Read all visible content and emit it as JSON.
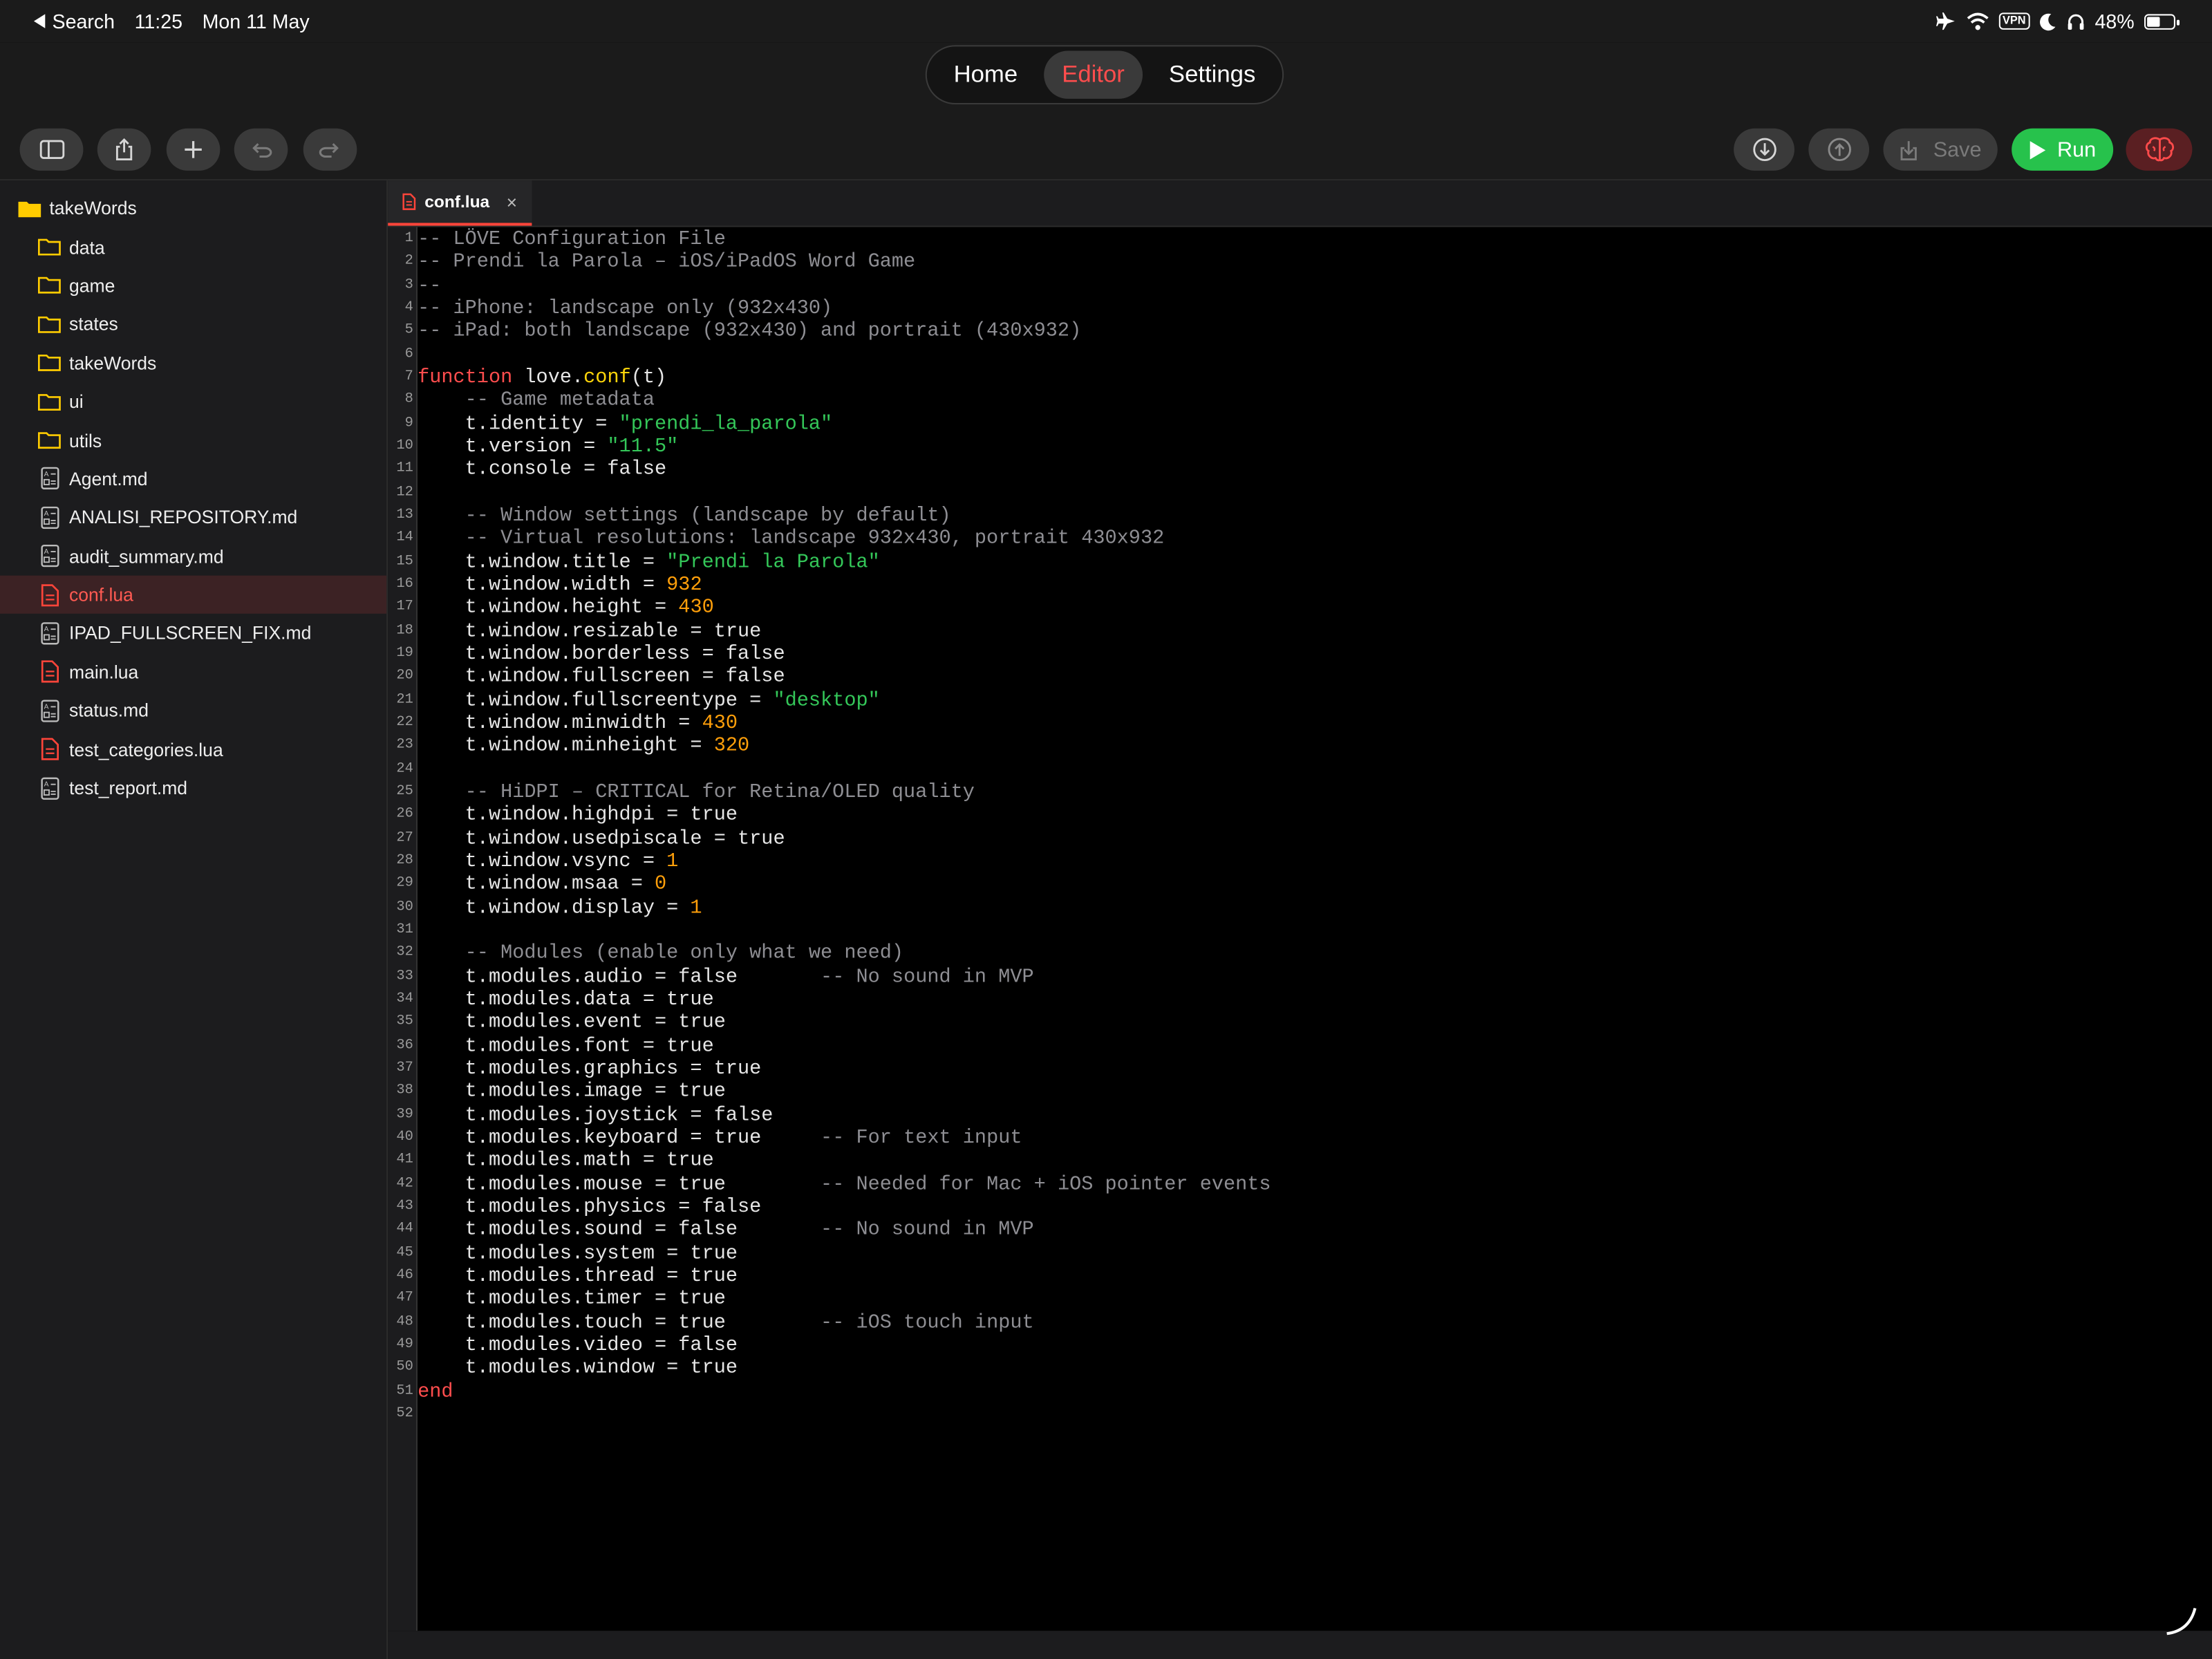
{
  "status_bar": {
    "back_label": "Search",
    "time": "11:25",
    "date": "Mon 11 May",
    "vpn_label": "VPN",
    "battery_percent": "48%",
    "battery_level": 0.48,
    "icons": [
      "airplane-icon",
      "wifi-icon",
      "vpn-badge",
      "moon-icon",
      "headphones-icon",
      "battery-icon"
    ]
  },
  "nav": {
    "tabs": [
      {
        "label": "Home",
        "active": false
      },
      {
        "label": "Editor",
        "active": true
      },
      {
        "label": "Settings",
        "active": false
      }
    ]
  },
  "toolbar": {
    "left_icons": [
      "sidebar-toggle-icon",
      "share-icon",
      "plus-icon",
      "undo-icon",
      "redo-icon"
    ],
    "download_icon": "download-icon",
    "upload_icon": "upload-icon",
    "save_label": "Save",
    "run_label": "Run",
    "ai_icon": "brain-icon"
  },
  "sidebar": {
    "root": "takeWords",
    "items": [
      {
        "label": "data",
        "type": "folder"
      },
      {
        "label": "game",
        "type": "folder"
      },
      {
        "label": "states",
        "type": "folder"
      },
      {
        "label": "takeWords",
        "type": "folder"
      },
      {
        "label": "ui",
        "type": "folder"
      },
      {
        "label": "utils",
        "type": "folder"
      },
      {
        "label": "Agent.md",
        "type": "md"
      },
      {
        "label": "ANALISI_REPOSITORY.md",
        "type": "md"
      },
      {
        "label": "audit_summary.md",
        "type": "md"
      },
      {
        "label": "conf.lua",
        "type": "lua",
        "selected": true
      },
      {
        "label": "IPAD_FULLSCREEN_FIX.md",
        "type": "md"
      },
      {
        "label": "main.lua",
        "type": "lua"
      },
      {
        "label": "status.md",
        "type": "md"
      },
      {
        "label": "test_categories.lua",
        "type": "lua"
      },
      {
        "label": "test_report.md",
        "type": "md"
      }
    ]
  },
  "editor": {
    "tab_label": "conf.lua",
    "close_glyph": "×",
    "lines": [
      [
        {
          "t": "-- LÖVE Configuration File",
          "k": "comment"
        }
      ],
      [
        {
          "t": "-- Prendi la Parola – iOS/iPadOS Word Game",
          "k": "comment"
        }
      ],
      [
        {
          "t": "--",
          "k": "comment"
        }
      ],
      [
        {
          "t": "-- iPhone: landscape only (932x430)",
          "k": "comment"
        }
      ],
      [
        {
          "t": "-- iPad: both landscape (932x430) and portrait (430x932)",
          "k": "comment"
        }
      ],
      [],
      [
        {
          "t": "function",
          "k": "keyword"
        },
        {
          "t": " love.",
          "k": "plain"
        },
        {
          "t": "conf",
          "k": "func"
        },
        {
          "t": "(t)",
          "k": "plain"
        }
      ],
      [
        {
          "t": "    -- Game metadata",
          "k": "comment"
        }
      ],
      [
        {
          "t": "    t.identity = ",
          "k": "plain"
        },
        {
          "t": "\"prendi_la_parola\"",
          "k": "string"
        }
      ],
      [
        {
          "t": "    t.version = ",
          "k": "plain"
        },
        {
          "t": "\"11.5\"",
          "k": "string"
        }
      ],
      [
        {
          "t": "    t.console = false",
          "k": "plain"
        }
      ],
      [],
      [
        {
          "t": "    -- Window settings (landscape by default)",
          "k": "comment"
        }
      ],
      [
        {
          "t": "    -- Virtual resolutions: landscape 932x430, portrait 430x932",
          "k": "comment"
        }
      ],
      [
        {
          "t": "    t.window.title = ",
          "k": "plain"
        },
        {
          "t": "\"Prendi la Parola\"",
          "k": "string"
        }
      ],
      [
        {
          "t": "    t.window.width = ",
          "k": "plain"
        },
        {
          "t": "932",
          "k": "number"
        }
      ],
      [
        {
          "t": "    t.window.height = ",
          "k": "plain"
        },
        {
          "t": "430",
          "k": "number"
        }
      ],
      [
        {
          "t": "    t.window.resizable = true",
          "k": "plain"
        }
      ],
      [
        {
          "t": "    t.window.borderless = false",
          "k": "plain"
        }
      ],
      [
        {
          "t": "    t.window.fullscreen = false",
          "k": "plain"
        }
      ],
      [
        {
          "t": "    t.window.fullscreentype = ",
          "k": "plain"
        },
        {
          "t": "\"desktop\"",
          "k": "string"
        }
      ],
      [
        {
          "t": "    t.window.minwidth = ",
          "k": "plain"
        },
        {
          "t": "430",
          "k": "number"
        }
      ],
      [
        {
          "t": "    t.window.minheight = ",
          "k": "plain"
        },
        {
          "t": "320",
          "k": "number"
        }
      ],
      [],
      [
        {
          "t": "    -- HiDPI – CRITICAL for Retina/OLED quality",
          "k": "comment"
        }
      ],
      [
        {
          "t": "    t.window.highdpi = true",
          "k": "plain"
        }
      ],
      [
        {
          "t": "    t.window.usedpiscale = true",
          "k": "plain"
        }
      ],
      [
        {
          "t": "    t.window.vsync = ",
          "k": "plain"
        },
        {
          "t": "1",
          "k": "number"
        }
      ],
      [
        {
          "t": "    t.window.msaa = ",
          "k": "plain"
        },
        {
          "t": "0",
          "k": "number"
        }
      ],
      [
        {
          "t": "    t.window.display = ",
          "k": "plain"
        },
        {
          "t": "1",
          "k": "number"
        }
      ],
      [],
      [
        {
          "t": "    -- Modules (enable only what we need)",
          "k": "comment"
        }
      ],
      [
        {
          "t": "    t.modules.audio = false       ",
          "k": "plain"
        },
        {
          "t": "-- No sound in MVP",
          "k": "comment"
        }
      ],
      [
        {
          "t": "    t.modules.data = true",
          "k": "plain"
        }
      ],
      [
        {
          "t": "    t.modules.event = true",
          "k": "plain"
        }
      ],
      [
        {
          "t": "    t.modules.font = true",
          "k": "plain"
        }
      ],
      [
        {
          "t": "    t.modules.graphics = true",
          "k": "plain"
        }
      ],
      [
        {
          "t": "    t.modules.image = true",
          "k": "plain"
        }
      ],
      [
        {
          "t": "    t.modules.joystick = false",
          "k": "plain"
        }
      ],
      [
        {
          "t": "    t.modules.keyboard = true     ",
          "k": "plain"
        },
        {
          "t": "-- For text input",
          "k": "comment"
        }
      ],
      [
        {
          "t": "    t.modules.math = true",
          "k": "plain"
        }
      ],
      [
        {
          "t": "    t.modules.mouse = true        ",
          "k": "plain"
        },
        {
          "t": "-- Needed for Mac + iOS pointer events",
          "k": "comment"
        }
      ],
      [
        {
          "t": "    t.modules.physics = false",
          "k": "plain"
        }
      ],
      [
        {
          "t": "    t.modules.sound = false       ",
          "k": "plain"
        },
        {
          "t": "-- No sound in MVP",
          "k": "comment"
        }
      ],
      [
        {
          "t": "    t.modules.system = true",
          "k": "plain"
        }
      ],
      [
        {
          "t": "    t.modules.thread = true",
          "k": "plain"
        }
      ],
      [
        {
          "t": "    t.modules.timer = true",
          "k": "plain"
        }
      ],
      [
        {
          "t": "    t.modules.touch = true        ",
          "k": "plain"
        },
        {
          "t": "-- iOS touch input",
          "k": "comment"
        }
      ],
      [
        {
          "t": "    t.modules.video = false",
          "k": "plain"
        }
      ],
      [
        {
          "t": "    t.modules.window = true",
          "k": "plain"
        }
      ],
      [
        {
          "t": "end",
          "k": "keyword"
        }
      ],
      []
    ]
  },
  "colors": {
    "accent_red": "#ff453a",
    "run_green": "#27c24c",
    "string_green": "#34c759",
    "number_orange": "#ff9f0a",
    "func_yellow": "#ffd60a",
    "comment_gray": "#8e8e93"
  }
}
